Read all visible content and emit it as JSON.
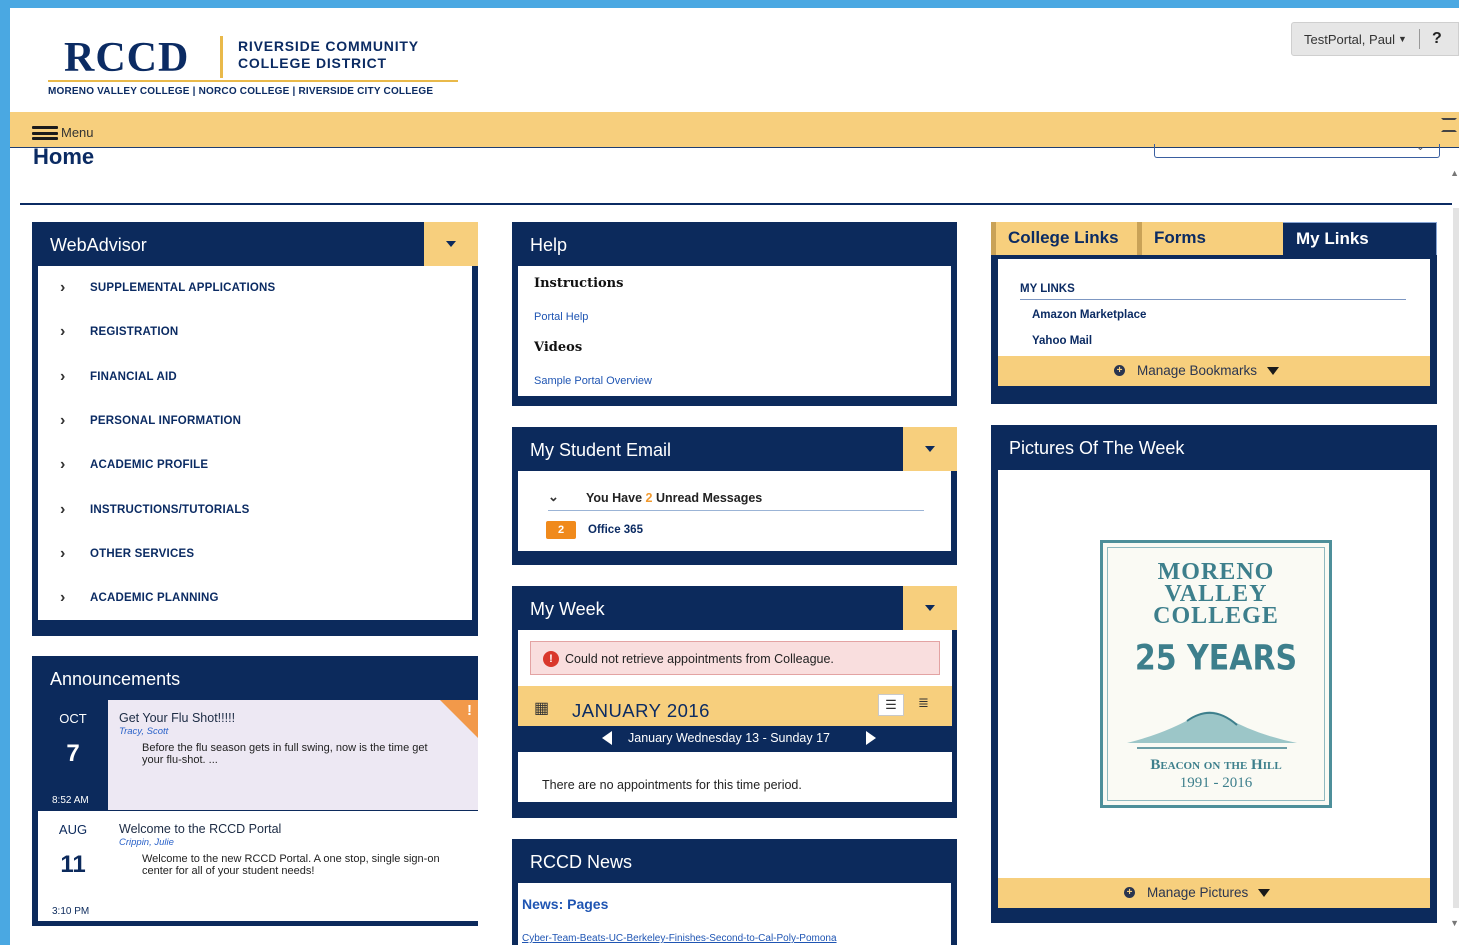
{
  "header": {
    "logo_mark": "RCCD",
    "logo_name_line1": "RIVERSIDE COMMUNITY",
    "logo_name_line2": "COLLEGE DISTRICT",
    "logo_colleges": "MORENO VALLEY COLLEGE | NORCO COLLEGE | RIVERSIDE CITY COLLEGE",
    "user_name": "TestPortal, Paul",
    "help_label": "?",
    "menu_label": "Menu"
  },
  "page": {
    "title": "Home"
  },
  "webadvisor": {
    "title": "WebAdvisor",
    "items": [
      {
        "label": "SUPPLEMENTAL APPLICATIONS"
      },
      {
        "label": "REGISTRATION"
      },
      {
        "label": "FINANCIAL AID"
      },
      {
        "label": "PERSONAL INFORMATION"
      },
      {
        "label": "ACADEMIC PROFILE"
      },
      {
        "label": "INSTRUCTIONS/TUTORIALS"
      },
      {
        "label": "OTHER SERVICES"
      },
      {
        "label": "ACADEMIC PLANNING"
      }
    ]
  },
  "announcements": {
    "title": "Announcements",
    "items": [
      {
        "month": "OCT",
        "day": "7",
        "time": "8:52 AM",
        "title": "Get Your Flu Shot!!!!!",
        "author": "Tracy, Scott",
        "text": "Before the flu season gets in full swing, now is the time get your flu-shot. ...",
        "flag": "!"
      },
      {
        "month": "AUG",
        "day": "11",
        "time": "3:10 PM",
        "title": "Welcome to the RCCD Portal",
        "author": "Crippin, Julie",
        "text": "Welcome to the new RCCD Portal.  A one stop, single sign-on center for all of your student needs!"
      }
    ]
  },
  "help": {
    "title": "Help",
    "section1": "Instructions",
    "link1": "Portal Help",
    "section2": "Videos",
    "link2": "Sample Portal Overview"
  },
  "email": {
    "title": "My Student Email",
    "summary_prefix": "You Have ",
    "unread_count": "2",
    "summary_suffix": " Unread Messages",
    "badge": "2",
    "account": "Office 365"
  },
  "week": {
    "title": "My Week",
    "alert": "Could not retrieve appointments from Colleague.",
    "month": "JANUARY 2016",
    "range": "January Wednesday 13 - Sunday 17",
    "empty": "There are no appointments for this time period."
  },
  "news": {
    "title": "RCCD News",
    "section": "News: Pages",
    "link": "Cyber-Team-Beats-UC-Berkeley-Finishes-Second-to-Cal-Poly-Pomona"
  },
  "links": {
    "tabs": [
      "College Links",
      "Forms",
      "My Links"
    ],
    "section_title": "MY LINKS",
    "items": [
      "Amazon Marketplace",
      "Yahoo Mail"
    ],
    "manage_label": "Manage Bookmarks"
  },
  "pictures": {
    "title": "Pictures Of The Week",
    "image_line1": "MORENO",
    "image_line2": "VALLEY",
    "image_line3": "COLLEGE",
    "image_years": "25 YEARS",
    "image_motto": "Beacon on the Hill",
    "image_dates": "1991 - 2016",
    "manage_label": "Manage Pictures"
  },
  "colors": {
    "navy": "#0c2a5c",
    "gold": "#f7cf7d",
    "frame_blue": "#4aa8e2",
    "badge_orange": "#f08a1c"
  },
  "icons": [
    "menu-icon",
    "chevron-right-icon",
    "chevron-down-icon",
    "calendar-icon",
    "list-view-icon",
    "plus-circle-icon",
    "alert-icon",
    "expand-icon"
  ]
}
